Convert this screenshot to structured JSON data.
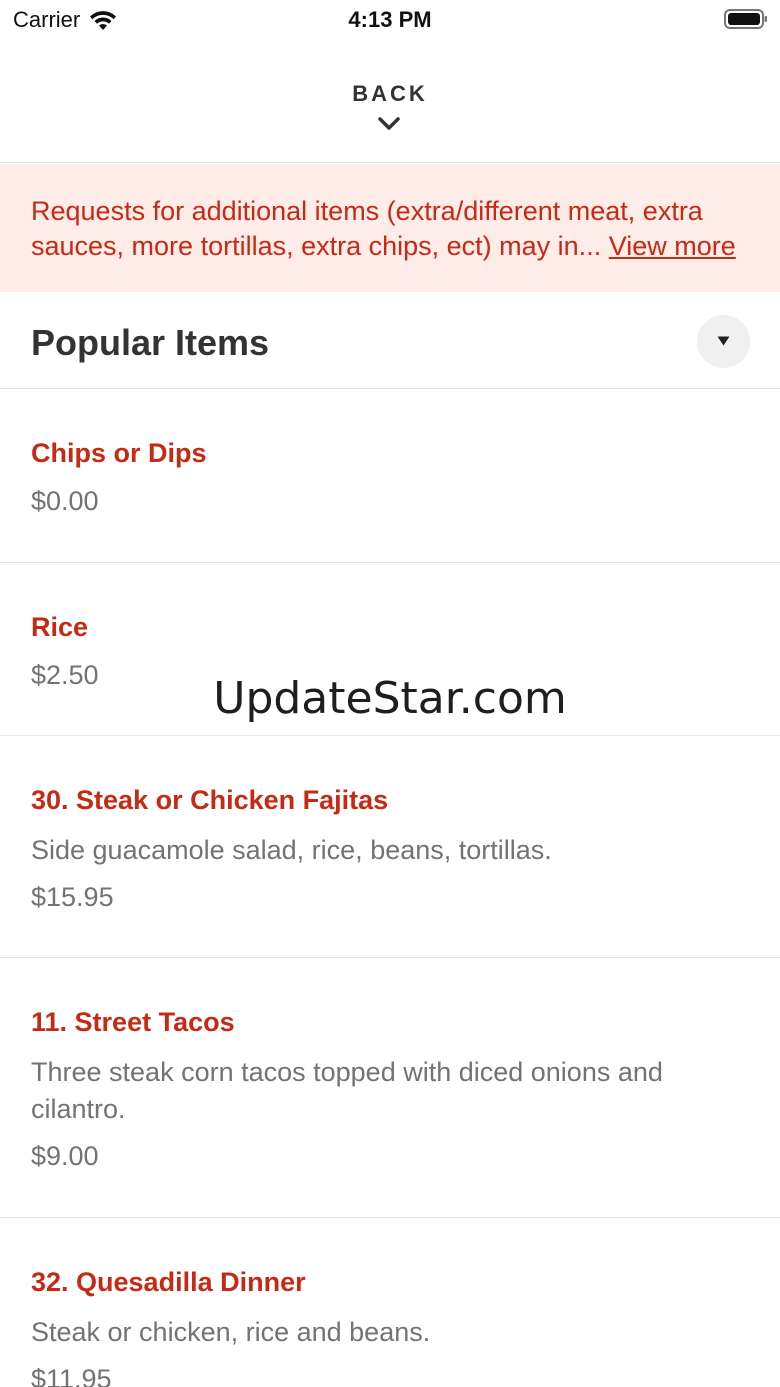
{
  "status_bar": {
    "carrier": "Carrier",
    "time": "4:13 PM"
  },
  "header": {
    "back_label": "BACK"
  },
  "notice": {
    "text": "Requests for additional items (extra/different meat, extra sauces, more tortillas, extra chips, ect) may in...",
    "link": "View more"
  },
  "section": {
    "title": "Popular Items"
  },
  "menu_items": [
    {
      "name": "Chips or Dips",
      "description": "",
      "price": "$0.00"
    },
    {
      "name": "Rice",
      "description": "",
      "price": "$2.50"
    },
    {
      "name": "30. Steak or Chicken Fajitas",
      "description": "Side guacamole salad, rice, beans, tortillas.",
      "price": "$15.95"
    },
    {
      "name": "11. Street Tacos",
      "description": "Three steak corn tacos topped with diced onions and cilantro.",
      "price": "$9.00"
    },
    {
      "name": "32. Quesadilla Dinner",
      "description": "Steak or chicken, rice and beans.",
      "price": "$11.95"
    }
  ],
  "watermark": "UpdateStar.com",
  "colors": {
    "accent": "#c72a14",
    "notice_bg": "#fdece8",
    "muted_text": "#737373",
    "title_text": "#333333"
  }
}
